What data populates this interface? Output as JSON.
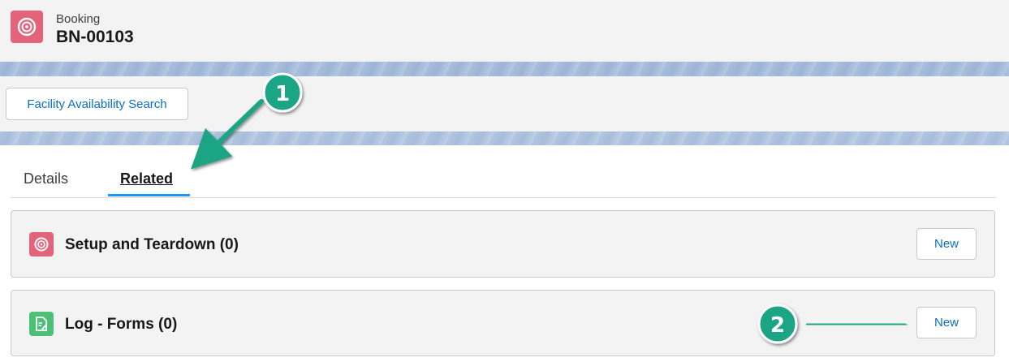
{
  "header": {
    "object_label": "Booking",
    "record_title": "BN-00103",
    "icon": "booking-icon",
    "icon_color": "#e3647a"
  },
  "actions": {
    "facility_search_label": "Facility Availability Search"
  },
  "tabs": [
    {
      "label": "Details",
      "active": false
    },
    {
      "label": "Related",
      "active": true
    }
  ],
  "related_lists": [
    {
      "title": "Setup and Teardown (0)",
      "icon": "setup-teardown-icon",
      "icon_color": "#e3647a",
      "new_label": "New"
    },
    {
      "title": "Log - Forms (0)",
      "icon": "form-log-icon",
      "icon_color": "#4bc076",
      "new_label": "New"
    }
  ],
  "callouts": [
    {
      "number": "1"
    },
    {
      "number": "2"
    }
  ],
  "colors": {
    "accent": "#1b96ff",
    "link": "#0b6fc6",
    "callout": "#1fa585"
  }
}
